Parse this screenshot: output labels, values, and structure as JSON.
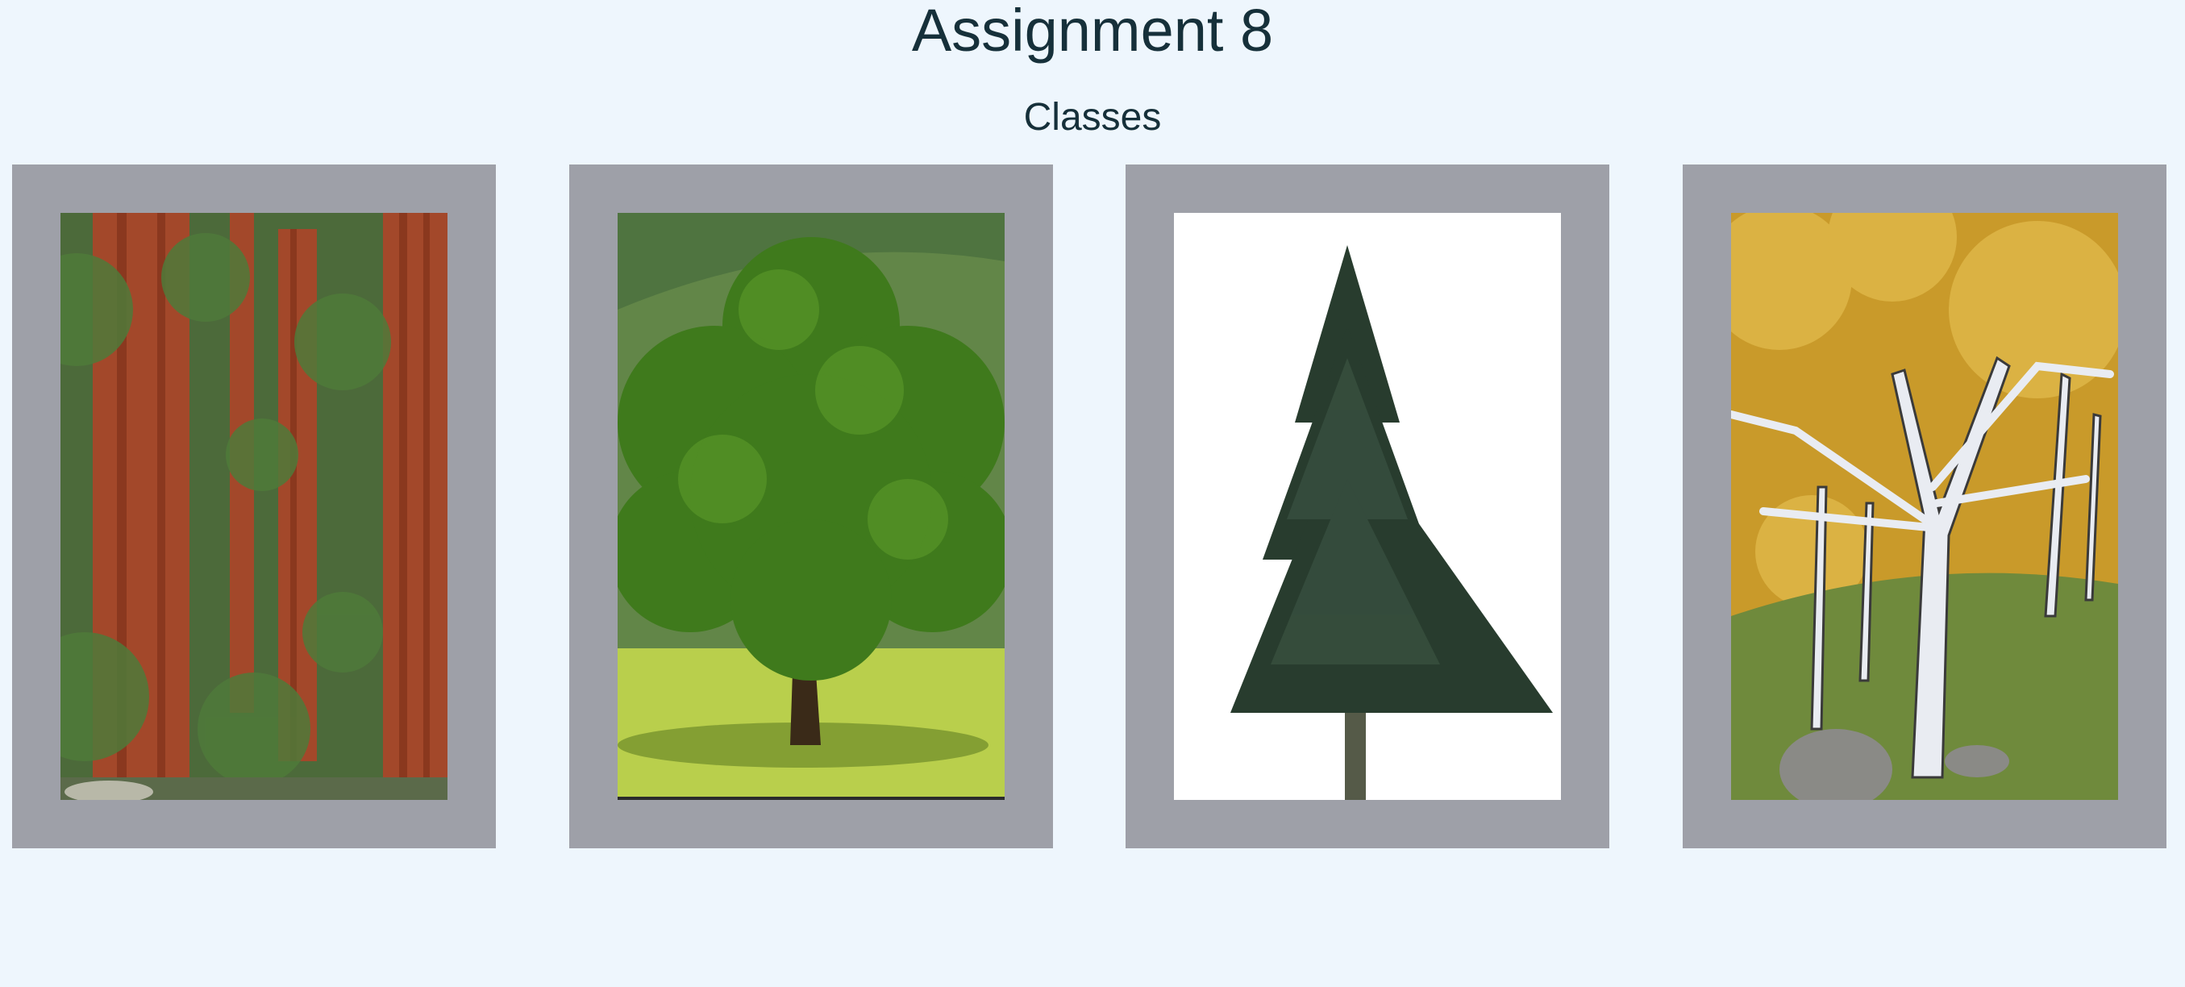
{
  "header": {
    "title": "Assignment 8",
    "subtitle": "Classes"
  },
  "gallery": {
    "frame_color": "#9ea0a8",
    "images": [
      {
        "subject": "redwood-forest"
      },
      {
        "subject": "oak-tree-in-meadow"
      },
      {
        "subject": "fir-tree"
      },
      {
        "subject": "birch-trees-autumn"
      }
    ]
  }
}
